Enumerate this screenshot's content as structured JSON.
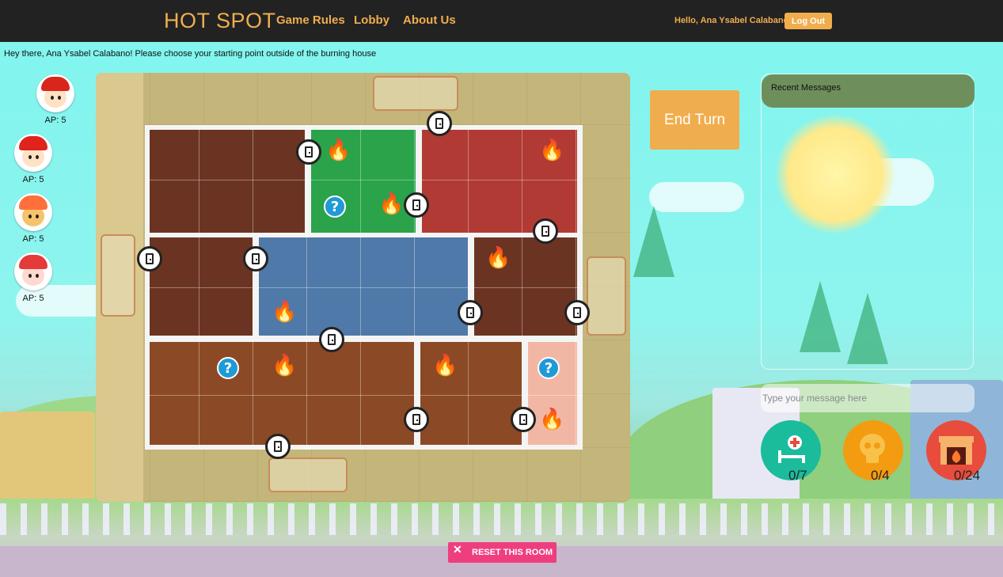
{
  "navbar": {
    "brand": "HOT SPOT",
    "links": [
      "Game Rules",
      "Lobby",
      "About Us"
    ],
    "greeting": "Hello, Ana Ysabel Calabano",
    "logout_label": "Log Out"
  },
  "status_message": "Hey there, Ana Ysabel Calabano! Please choose your starting point outside of the burning house",
  "players": [
    {
      "ap_label": "AP: 5",
      "hat_color": "#d9261c"
    },
    {
      "ap_label": "AP: 5",
      "hat_color": "#e0231d"
    },
    {
      "ap_label": "AP: 5",
      "hat_color": "#ff6f3c"
    },
    {
      "ap_label": "AP: 5",
      "hat_color": "#e43a3a"
    }
  ],
  "end_turn_label": "End Turn",
  "chat": {
    "header": "Recent Messages",
    "placeholder": "Type your message here"
  },
  "counters": {
    "victims_rescued": "0/7",
    "victims_lost": "0/4",
    "damage": "0/24"
  },
  "reset_label": "RESET THIS ROOM",
  "reset_icon": "close-icon",
  "colors": {
    "accent": "#f0ad4e",
    "navbar_bg": "#222222",
    "chat_header": "#6e8f5c",
    "reset_bg": "#ef3e7f",
    "victims_rescued_bg": "#1abc9c",
    "victims_lost_bg": "#f39c12",
    "damage_bg": "#e74c3c"
  }
}
